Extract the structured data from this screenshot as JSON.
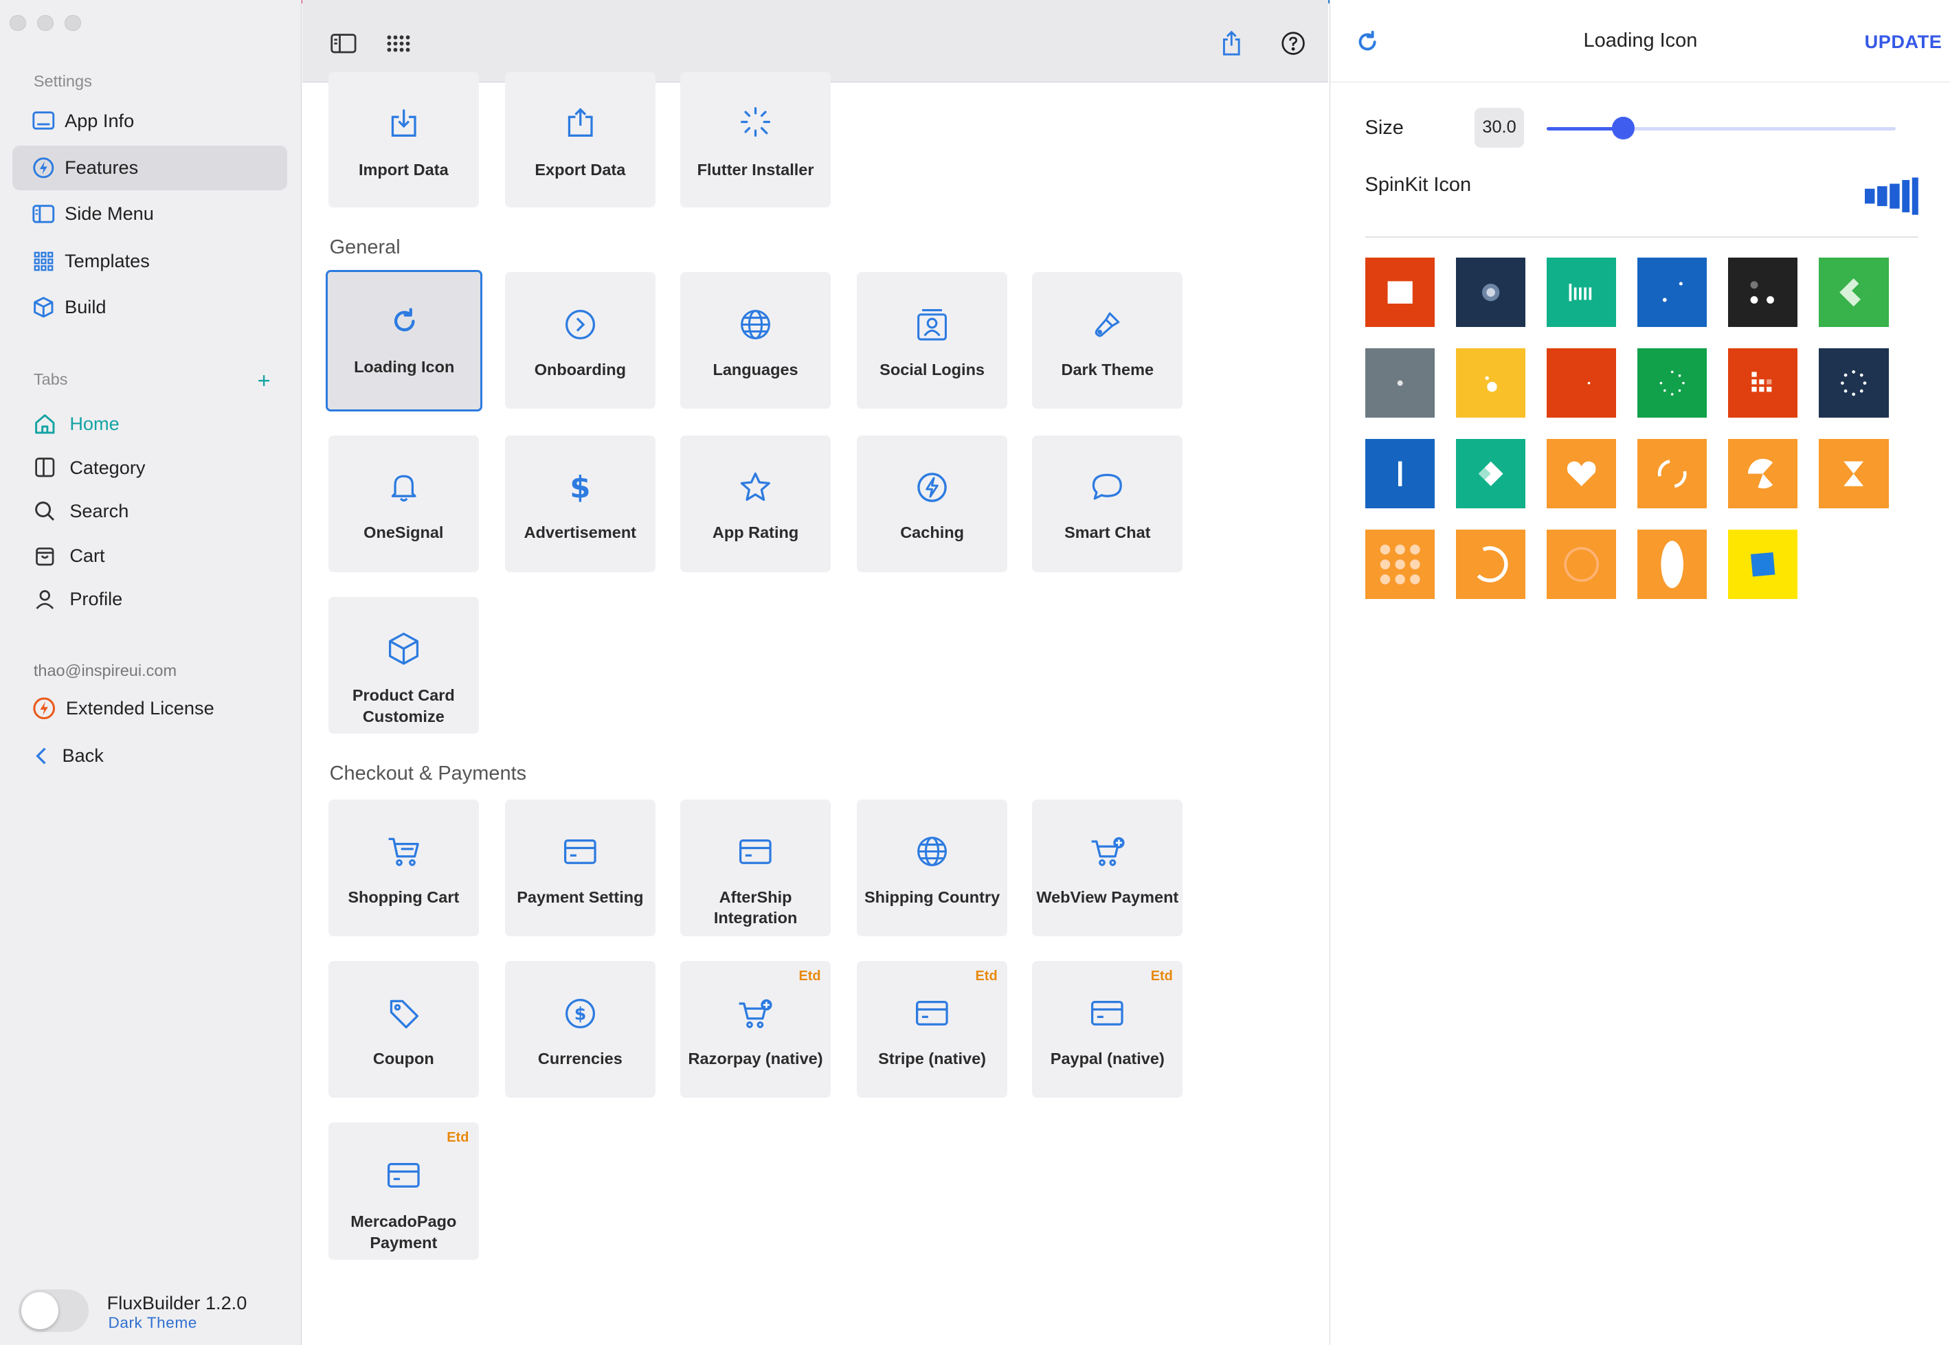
{
  "sidebar": {
    "settings_label": "Settings",
    "items": [
      {
        "label": "App Info"
      },
      {
        "label": "Features"
      },
      {
        "label": "Side Menu"
      },
      {
        "label": "Templates"
      },
      {
        "label": "Build"
      }
    ],
    "tabs_label": "Tabs",
    "tabs": [
      {
        "label": "Home"
      },
      {
        "label": "Category"
      },
      {
        "label": "Search"
      },
      {
        "label": "Cart"
      },
      {
        "label": "Profile"
      }
    ],
    "email": "thao@inspireui.com",
    "license": "Extended License",
    "back": "Back",
    "version": "FluxBuilder 1.2.0",
    "theme_link": "Dark Theme"
  },
  "main": {
    "top_cards": [
      {
        "label": "Import Data"
      },
      {
        "label": "Export Data"
      },
      {
        "label": "Flutter Installer"
      }
    ],
    "general_title": "General",
    "general_cards": [
      {
        "label": "Loading Icon"
      },
      {
        "label": "Onboarding"
      },
      {
        "label": "Languages"
      },
      {
        "label": "Social Logins"
      },
      {
        "label": "Dark Theme"
      },
      {
        "label": "OneSignal"
      },
      {
        "label": "Advertisement"
      },
      {
        "label": "App Rating"
      },
      {
        "label": "Caching"
      },
      {
        "label": "Smart Chat"
      },
      {
        "label": "Product Card Customize"
      }
    ],
    "checkout_title": "Checkout & Payments",
    "checkout_cards": [
      {
        "label": "Shopping Cart"
      },
      {
        "label": "Payment Setting"
      },
      {
        "label": "AfterShip Integration"
      },
      {
        "label": "Shipping Country"
      },
      {
        "label": "WebView Payment"
      },
      {
        "label": "Coupon"
      },
      {
        "label": "Currencies"
      },
      {
        "label": "Razorpay (native)",
        "badge": "Etd"
      },
      {
        "label": "Stripe (native)",
        "badge": "Etd"
      },
      {
        "label": "Paypal (native)",
        "badge": "Etd"
      },
      {
        "label": "MercadoPago Payment",
        "badge": "Etd"
      }
    ]
  },
  "panel": {
    "title": "Loading Icon",
    "update": "UPDATE",
    "size_label": "Size",
    "size_value": "30.0",
    "size_fraction": 0.22,
    "spinkit_label": "SpinKit Icon",
    "tile_colors": [
      "#e0400f",
      "#1e3350",
      "#10b08a",
      "#1565c0",
      "#222222",
      "#38b24a",
      "#6e7a82",
      "#f9c02a",
      "#e0400f",
      "#11a14a",
      "#e0400f",
      "#1e3350",
      "#1565c0",
      "#10b08a",
      "#f89a2c",
      "#f89a2c",
      "#f89a2c",
      "#f89a2c",
      "#f89a2c",
      "#f89a2c",
      "#f89a2c",
      "#f89a2c",
      "#ffe600"
    ]
  },
  "colors": {
    "accent": "#2d7be0",
    "teal": "#14a3a3",
    "update_blue": "#3558e6",
    "etd_orange": "#e8890c"
  }
}
